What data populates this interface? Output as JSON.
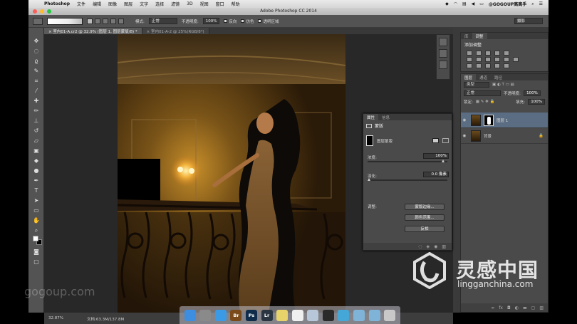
{
  "menubar": {
    "app_name": "Photoshop",
    "items": [
      "文件",
      "编辑",
      "图像",
      "图层",
      "文字",
      "选择",
      "滤镜",
      "3D",
      "视图",
      "窗口",
      "帮助"
    ],
    "right_user": "@GOGOUP高高手"
  },
  "window": {
    "title": "Adobe Photoshop CC 2014"
  },
  "options_bar": {
    "mode_label": "模式:",
    "mode_value": "正常",
    "opacity_label": "不透明度:",
    "opacity_value": "100%",
    "reverse_label": "反向",
    "dither_label": "仿色",
    "transparency_label": "透明区域",
    "workspace_value": "摄影"
  },
  "tabs": [
    {
      "label": "室内01-A.cr2 @ 32.9% (图层 1, 图层蒙版/8) *",
      "active": true
    },
    {
      "label": "室内01-A-2 @ 25%(RGB/8*)",
      "active": false
    }
  ],
  "status": {
    "zoom": "32.87%",
    "doc": "文档:63.3M/137.8M"
  },
  "adjustments_panel": {
    "tabs": [
      "库",
      "调整"
    ],
    "active_tab": "调整",
    "title": "添加调整"
  },
  "layers_panel": {
    "tabs": [
      "图层",
      "通道",
      "路径"
    ],
    "active_tab": "图层",
    "filter_value": "类型",
    "blend_value": "正常",
    "opacity_label": "不透明度:",
    "opacity_value": "100%",
    "lock_label": "锁定:",
    "fill_label": "填充:",
    "fill_value": "100%",
    "layers": [
      {
        "name": "图层 1",
        "has_mask": true,
        "selected": true
      },
      {
        "name": "背景",
        "has_mask": false,
        "selected": false,
        "locked": true
      }
    ]
  },
  "properties_panel": {
    "tabs": [
      "属性",
      "信息"
    ],
    "header": "蒙版",
    "mask_type": "图层蒙版",
    "density_label": "浓度:",
    "density_value": "100%",
    "density": 1.0,
    "feather_label": "羽化:",
    "feather_value": "0.0 像素",
    "feather": 0.0,
    "refine_label": "调整:",
    "buttons": [
      "蒙版边缘...",
      "颜色范围...",
      "反相"
    ]
  },
  "dock": {
    "apps": [
      {
        "label": "",
        "name": "finder",
        "color": "#3d8de0"
      },
      {
        "label": "",
        "name": "launchpad",
        "color": "#8a8a8a"
      },
      {
        "label": "",
        "name": "safari",
        "color": "#3a9ae6"
      },
      {
        "label": "Br",
        "name": "bridge",
        "color": "#7b4a1a"
      },
      {
        "label": "Ps",
        "name": "photoshop",
        "color": "#0f2d4a"
      },
      {
        "label": "Lr",
        "name": "lightroom",
        "color": "#2b3542"
      },
      {
        "label": "",
        "name": "notes",
        "color": "#e8d36a"
      },
      {
        "label": "",
        "name": "ical",
        "color": "#efefef"
      },
      {
        "label": "",
        "name": "preview",
        "color": "#b7c6d8"
      },
      {
        "label": "",
        "name": "quicktime",
        "color": "#2a2a2a"
      },
      {
        "label": "",
        "name": "app",
        "color": "#45a7d8"
      },
      {
        "label": "",
        "name": "folder",
        "color": "#7fb3d8"
      },
      {
        "label": "",
        "name": "downloads",
        "color": "#7fb3d8"
      },
      {
        "label": "",
        "name": "trash",
        "color": "#c8c8c8"
      }
    ]
  },
  "watermarks": {
    "left": "gogoup.com",
    "right_cn": "灵感中国",
    "right_en": "lingganchina.com"
  },
  "colors": {
    "ui_bg": "#535353",
    "panel_bg": "#4a4a4a",
    "canvas_bg": "#282828",
    "selected_layer": "#5b6d82"
  }
}
